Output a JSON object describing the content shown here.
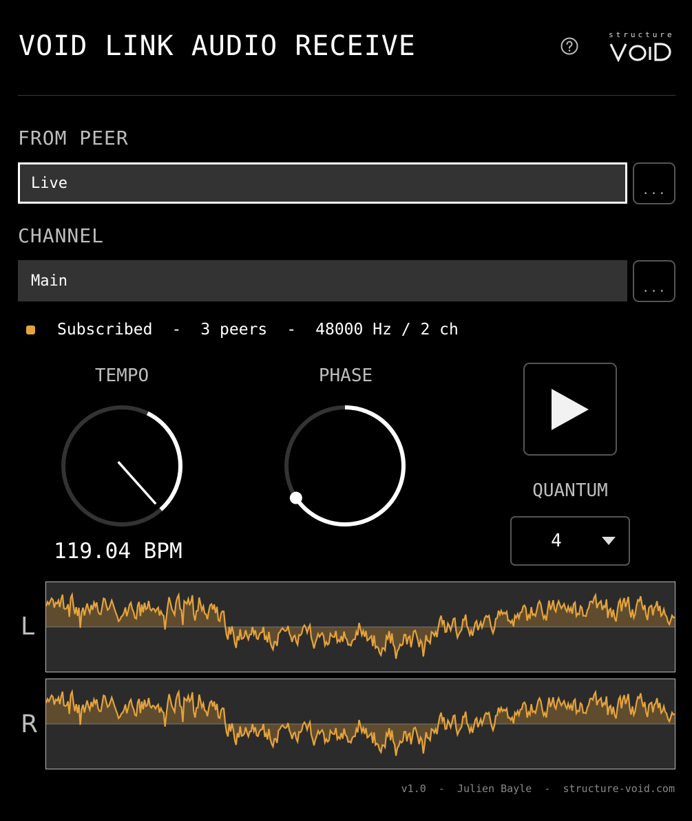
{
  "header": {
    "title": "VOID LINK AUDIO RECEIVE",
    "help_icon": "question-circle-icon",
    "logo_small": "structure",
    "logo_big": "VOID"
  },
  "from_peer": {
    "label": "FROM PEER",
    "value": "Live",
    "more_label": "..."
  },
  "channel": {
    "label": "CHANNEL",
    "value": "Main",
    "more_label": "..."
  },
  "status": {
    "state": "Subscribed",
    "separator": "-",
    "peers": "3 peers",
    "format": "48000 Hz / 2 ch",
    "dot_color": "#e5a33b"
  },
  "tempo": {
    "label": "TEMPO",
    "readout": "119.04 BPM",
    "fraction": 0.62
  },
  "phase": {
    "label": "PHASE",
    "fraction": 0.63
  },
  "transport": {
    "play_icon": "play-icon"
  },
  "quantum": {
    "label": "QUANTUM",
    "value": "4",
    "dropdown_icon": "triangle-down-icon"
  },
  "meters": {
    "left_label": "L",
    "right_label": "R",
    "wave_color": "#e5a33b"
  },
  "footer": {
    "text": "v1.0  -  Julien Bayle  -  structure-void.com"
  }
}
